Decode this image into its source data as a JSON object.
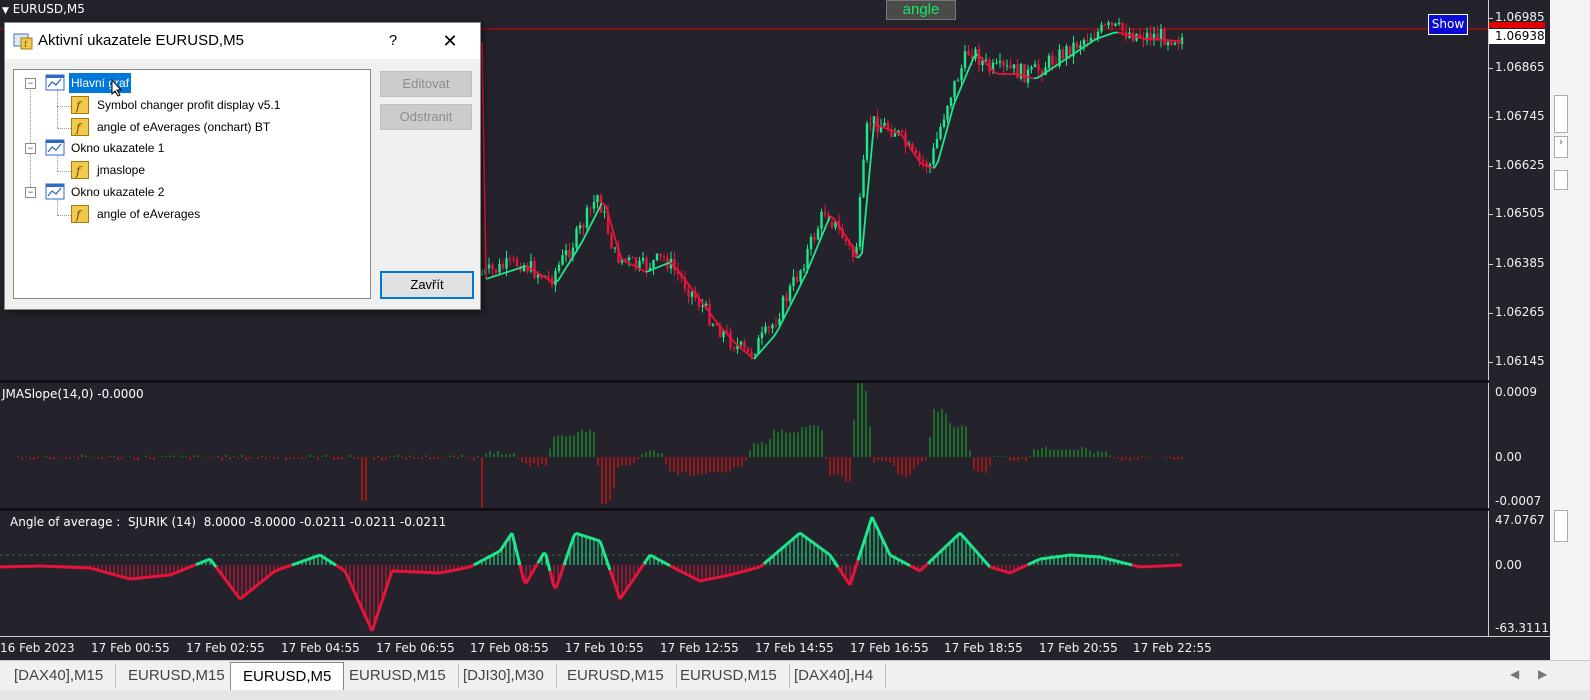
{
  "chart": {
    "title": "EURUSD,M5",
    "price_labels": [
      "1.06985",
      "1.06865",
      "1.06745",
      "1.06625",
      "1.06505",
      "1.06385",
      "1.06265",
      "1.06145"
    ],
    "current_price": "1.06938",
    "angle_button": "angle",
    "show_button": "Show",
    "colors": {
      "background": "#24232b",
      "bull": "#1de88c",
      "bear": "#e8143c",
      "price_line": "#d00000"
    }
  },
  "jma_pane": {
    "label": "JMASlope(14,0) -0.0000",
    "axis_labels": [
      "0.0009",
      "0.00",
      "-0.0007"
    ]
  },
  "angle_pane": {
    "label": "Angle of average :  SJURIK (14)  8.0000 -8.0000 -0.0211 -0.0211 -0.0211",
    "axis_labels": [
      "47.0767",
      "0.00",
      "-63.3111"
    ]
  },
  "time_axis": [
    "16 Feb 2023",
    "17 Feb 00:55",
    "17 Feb 02:55",
    "17 Feb 04:55",
    "17 Feb 06:55",
    "17 Feb 08:55",
    "17 Feb 10:55",
    "17 Feb 12:55",
    "17 Feb 14:55",
    "17 Feb 16:55",
    "17 Feb 18:55",
    "17 Feb 20:55",
    "17 Feb 22:55"
  ],
  "tabs": [
    "[DAX40],M15",
    "EURUSD,M15",
    "EURUSD,M5",
    "EURUSD,M15",
    "[DJI30],M30",
    "EURUSD,M15",
    "EURUSD,M15",
    "[DAX40],H4"
  ],
  "active_tab": "EURUSD,M5",
  "dialog": {
    "title": "Aktivní ukazatele EURUSD,M5",
    "help": "?",
    "close": "✕",
    "edit_button": "Editovat",
    "remove_button": "Odstranit",
    "close_button": "Zavřít",
    "tree": [
      {
        "label": "Hlavní graf",
        "children": [
          "Symbol changer profit display v5.1",
          "angle of eAverages (onchart) BT"
        ]
      },
      {
        "label": "Okno ukazatele 1",
        "children": [
          "jmaslope"
        ]
      },
      {
        "label": "Okno ukazatele 2",
        "children": [
          "angle of eAverages"
        ]
      }
    ]
  }
}
